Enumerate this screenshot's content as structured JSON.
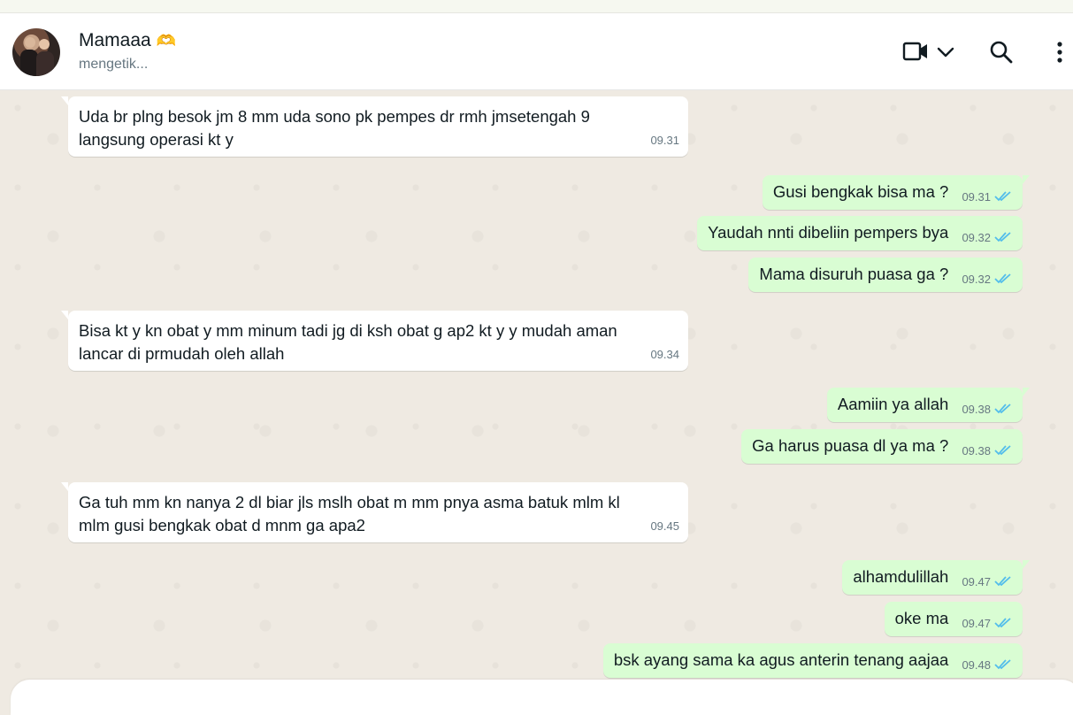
{
  "contact": {
    "name": "Mamaaa",
    "emoji": "🫶",
    "status": "mengetik..."
  },
  "header_icons": [
    "video-call-icon",
    "chevron-down-icon",
    "search-icon",
    "menu-icon"
  ],
  "colors": {
    "incoming_bubble": "#ffffff",
    "outgoing_bubble": "#d9fdd3",
    "read_ticks": "#53bdeb",
    "chat_background": "#efeae2"
  },
  "messages": [
    {
      "dir": "in",
      "text": "Uda br plng besok jm 8 mm uda sono pk pempes dr rmh jmsetengah 9 langsung operasi kt y",
      "time": "09.31"
    },
    {
      "dir": "out",
      "text": "Gusi bengkak bisa ma ?",
      "time": "09.31",
      "status": "read"
    },
    {
      "dir": "out",
      "text": "Yaudah nnti dibeliin pempers bya",
      "time": "09.32",
      "status": "read"
    },
    {
      "dir": "out",
      "text": "Mama disuruh puasa ga ?",
      "time": "09.32",
      "status": "read"
    },
    {
      "dir": "in",
      "text": "Bisa kt y kn obat y mm minum tadi jg di ksh obat g ap2 kt y y mudah aman lancar di prmudah oleh allah",
      "time": "09.34"
    },
    {
      "dir": "out",
      "text": "Aamiin ya allah",
      "time": "09.38",
      "status": "read"
    },
    {
      "dir": "out",
      "text": "Ga harus puasa dl ya ma ?",
      "time": "09.38",
      "status": "read"
    },
    {
      "dir": "in",
      "text": "Ga tuh mm kn nanya 2 dl biar jls mslh obat m mm pnya asma batuk mlm kl mlm gusi bengkak obat d mnm ga apa2",
      "time": "09.45"
    },
    {
      "dir": "out",
      "text": "alhamdulillah",
      "time": "09.47",
      "status": "read"
    },
    {
      "dir": "out",
      "text": "oke ma",
      "time": "09.47",
      "status": "read"
    },
    {
      "dir": "out",
      "text": "bsk ayang sama ka agus anterin tenang aajaa",
      "time": "09.48",
      "status": "read"
    }
  ]
}
